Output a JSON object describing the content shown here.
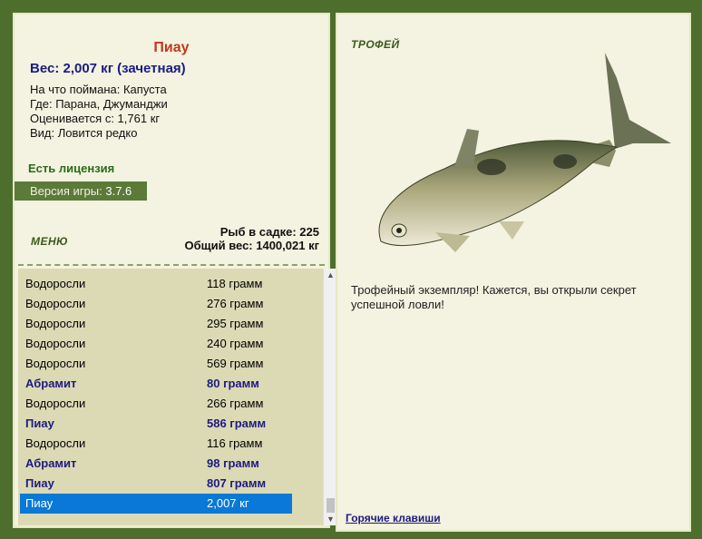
{
  "fish": {
    "name": "Пиау",
    "weight": "Вес: 2,007 кг (зачетная)",
    "bait": "На что поймана: Капуста",
    "place": "Где: Парана, Джуманджи",
    "valued": "Оценивается с: 1,761 кг",
    "species": "Вид: Ловится редко"
  },
  "license": "Есть лицензия",
  "version": {
    "label": "Версия игры:",
    "value": "3.7.6"
  },
  "menu_label": "МЕНЮ",
  "stats": {
    "count": "Рыб в садке: 225",
    "total": "Общий вес: 1400,021 кг"
  },
  "catch_list": [
    {
      "name": "Водоросли",
      "weight": "118 грамм",
      "bold": false
    },
    {
      "name": "Водоросли",
      "weight": "276 грамм",
      "bold": false
    },
    {
      "name": "Водоросли",
      "weight": "295 грамм",
      "bold": false
    },
    {
      "name": "Водоросли",
      "weight": "240 грамм",
      "bold": false
    },
    {
      "name": "Водоросли",
      "weight": "569 грамм",
      "bold": false
    },
    {
      "name": "Абрамит",
      "weight": "80 грамм",
      "bold": true
    },
    {
      "name": "Водоросли",
      "weight": "266 грамм",
      "bold": false
    },
    {
      "name": "Пиау",
      "weight": "586 грамм",
      "bold": true
    },
    {
      "name": "Водоросли",
      "weight": "116 грамм",
      "bold": false
    },
    {
      "name": "Абрамит",
      "weight": "98 грамм",
      "bold": true
    },
    {
      "name": "Пиау",
      "weight": "807 грамм",
      "bold": true
    },
    {
      "name": "Пиау",
      "weight": "2,007 кг",
      "bold": true,
      "selected": true
    }
  ],
  "trophy_label": "ТРОФЕЙ",
  "description": "Трофейный экземпляр! Кажется, вы открыли секрет успешной ловли!",
  "hotkeys": "Горячие клавиши",
  "colors": {
    "background": "#4e6e2e",
    "panel": "#f4f2e0",
    "selection": "#0a78d6",
    "title": "#c0391b"
  }
}
